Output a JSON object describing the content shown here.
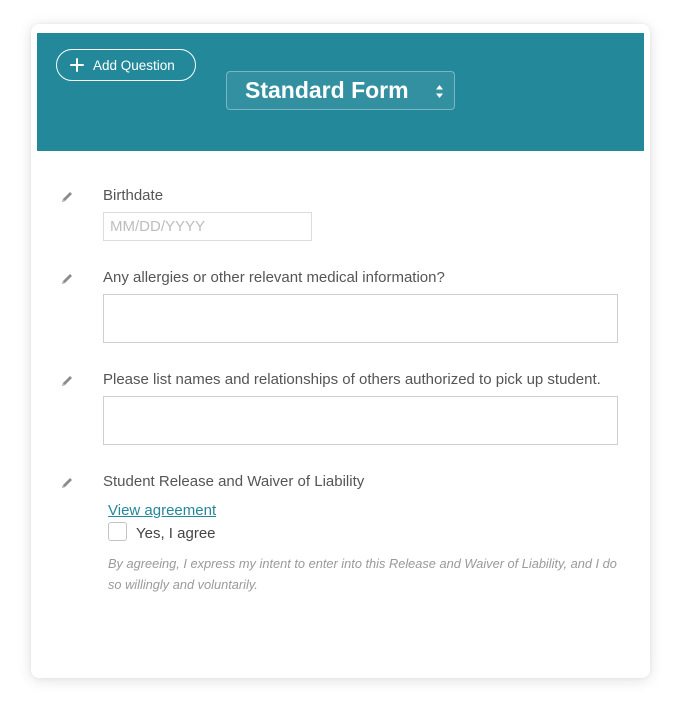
{
  "header": {
    "add_question_label": "Add Question",
    "form_type_value": "Standard Form",
    "background_color": "#23889a"
  },
  "questions": [
    {
      "label": "Birthdate",
      "placeholder": "MM/DD/YYYY",
      "value": ""
    },
    {
      "label": "Any allergies or other relevant medical information?",
      "value": ""
    },
    {
      "label": "Please list names and relationships of others authorized to pick up student.",
      "value": ""
    },
    {
      "label": "Student Release and Waiver of Liability",
      "link_label": "View agreement",
      "checkbox_label": "Yes, I agree",
      "checked": false,
      "disclaimer": "By agreeing, I express my intent to enter into this Release and Waiver of Liability, and I do so willingly and voluntarily."
    }
  ],
  "icons": {
    "add": "plus-icon",
    "select": "up-down-arrows-icon",
    "edit": "pencil-icon"
  },
  "colors": {
    "accent": "#23889a",
    "link": "#23889a"
  }
}
